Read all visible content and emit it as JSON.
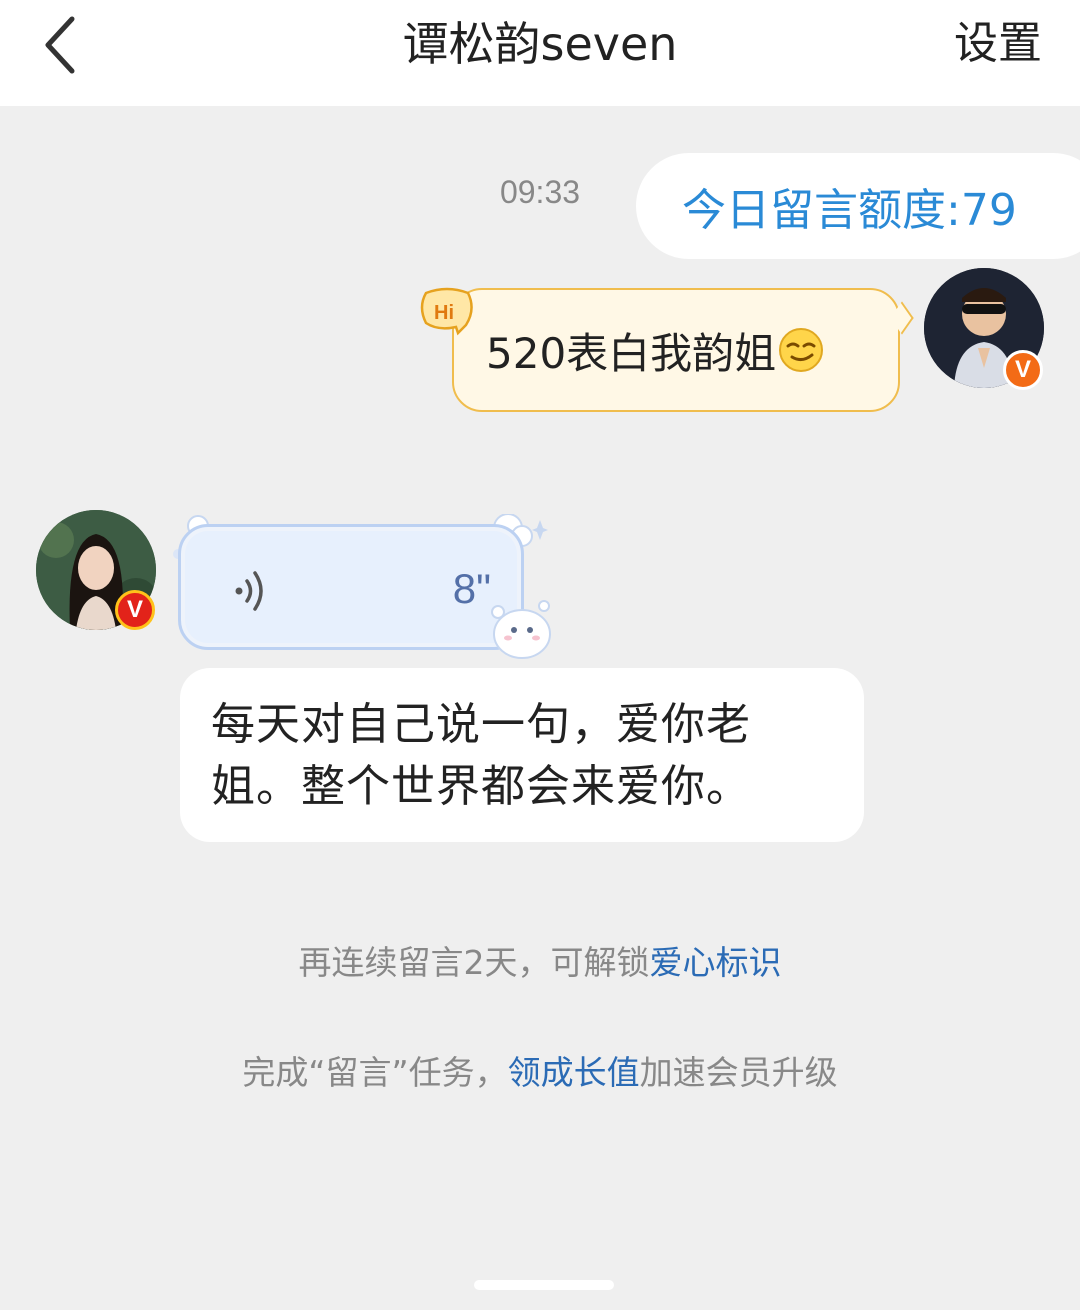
{
  "header": {
    "title": "谭松韵seven",
    "settings_label": "设置"
  },
  "chat": {
    "timestamp": "09:33",
    "quota_text": "今日留言额度:79",
    "hi_badge": "Hi",
    "sent_message": "520表白我韵姐",
    "voice_duration": "8\"",
    "reply_text_line1": "每天对自己说一句，爱你老",
    "reply_text_line2": "姐。整个世界都会来爱你。",
    "verified_mark": "V"
  },
  "tips": {
    "tip1_prefix": "再连续留言2天，可解锁",
    "tip1_link": "爱心标识",
    "tip2_prefix": "完成“留言”任务，",
    "tip2_link": "领成长值",
    "tip2_suffix": "加速会员升级"
  },
  "colors": {
    "accent_blue": "#2a8ad6",
    "link_blue": "#2b6bb5",
    "bubble_gold": "#f0bd4d",
    "badge_orange": "#f36b16"
  }
}
